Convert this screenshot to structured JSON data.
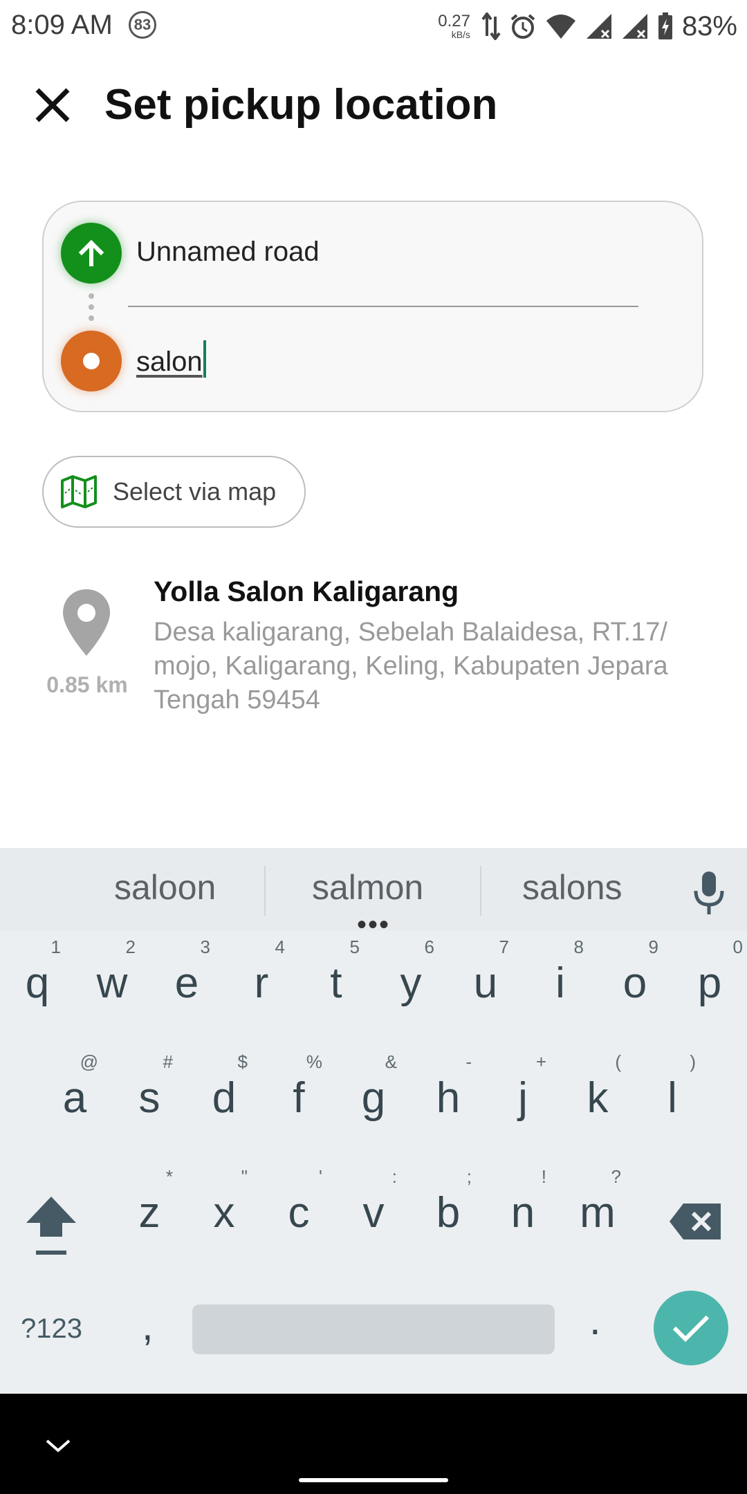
{
  "status_bar": {
    "time": "8:09 AM",
    "notification_badge": "83",
    "net_speed_value": "0.27",
    "net_speed_unit": "kB/s",
    "battery": "83%"
  },
  "header": {
    "title": "Set pickup location",
    "close_icon": "close-icon"
  },
  "route": {
    "origin": "Unnamed road",
    "destination_value": "salon",
    "origin_color": "#13901b",
    "destination_color": "#d86a22"
  },
  "map_chip": {
    "label": "Select via map",
    "icon": "map-icon"
  },
  "results": [
    {
      "name": "Yolla Salon Kaligarang",
      "address": "Desa kaligarang, Sebelah Balaidesa, RT.17/ mojo, Kaligarang, Keling, Kabupaten Jepara Tengah 59454",
      "distance": "0.85 km",
      "icon": "location-pin-icon"
    }
  ],
  "keyboard": {
    "suggestions": [
      "saloon",
      "salmon",
      "salons"
    ],
    "row1": [
      {
        "k": "q",
        "h": "1"
      },
      {
        "k": "w",
        "h": "2"
      },
      {
        "k": "e",
        "h": "3"
      },
      {
        "k": "r",
        "h": "4"
      },
      {
        "k": "t",
        "h": "5"
      },
      {
        "k": "y",
        "h": "6"
      },
      {
        "k": "u",
        "h": "7"
      },
      {
        "k": "i",
        "h": "8"
      },
      {
        "k": "o",
        "h": "9"
      },
      {
        "k": "p",
        "h": "0"
      }
    ],
    "row2": [
      {
        "k": "a",
        "h": "@"
      },
      {
        "k": "s",
        "h": "#"
      },
      {
        "k": "d",
        "h": "$"
      },
      {
        "k": "f",
        "h": "%"
      },
      {
        "k": "g",
        "h": "&"
      },
      {
        "k": "h",
        "h": "-"
      },
      {
        "k": "j",
        "h": "+"
      },
      {
        "k": "k",
        "h": "("
      },
      {
        "k": "l",
        "h": ")"
      }
    ],
    "row3": [
      {
        "k": "z",
        "h": "*"
      },
      {
        "k": "x",
        "h": "\""
      },
      {
        "k": "c",
        "h": "'"
      },
      {
        "k": "v",
        "h": ":"
      },
      {
        "k": "b",
        "h": ";"
      },
      {
        "k": "n",
        "h": "!"
      },
      {
        "k": "m",
        "h": "?"
      }
    ],
    "symbols_label": "?123",
    "comma": ",",
    "period": ".",
    "accent_color": "#4db6ac"
  }
}
